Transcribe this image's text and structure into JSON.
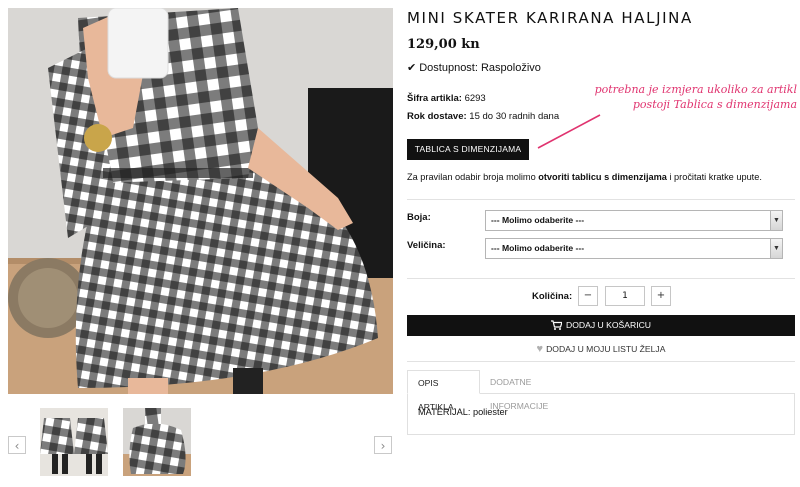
{
  "product": {
    "title": "MINI SKATER KARIRANA HALJINA",
    "price": "129,00 kn",
    "availability": "Dostupnost: Raspoloživo",
    "sku_label": "Šifra artikla:",
    "sku_value": "6293",
    "delivery_label": "Rok dostave:",
    "delivery_value": "15 do 30 radnih dana",
    "size_table_button": "TABLICA S DIMENZIJAMA",
    "instructions": {
      "before": "Za pravilan odabir broja molimo ",
      "bold": "otvoriti tablicu s dimenzijama",
      "after": " i pročitati kratke upute."
    }
  },
  "annotation": {
    "line1": "potrebna je izmjera ukoliko za artikl",
    "line2": "postoji Tablica s dimenzijama",
    "color": "#e0336f"
  },
  "options": {
    "color_label": "Boja:",
    "color_value": "--- Molimo odaberite ---",
    "size_label": "Veličina:",
    "size_value": "--- Molimo odaberite ---"
  },
  "quantity": {
    "label": "Količina:",
    "minus": "−",
    "value": "1",
    "plus": "+"
  },
  "actions": {
    "add_to_cart": "DODAJ U KOŠARICU",
    "wishlist": "DODAJ U MOJU LISTU ŽELJA"
  },
  "tabs": {
    "active": "OPIS ARTIKLA",
    "inactive": "DODATNE INFORMACIJE",
    "material": "MATERIJAL: poliester"
  },
  "gallery": {
    "prev": "‹",
    "next": "›",
    "icons": [
      "cart-icon",
      "heart-icon",
      "check-icon"
    ]
  }
}
